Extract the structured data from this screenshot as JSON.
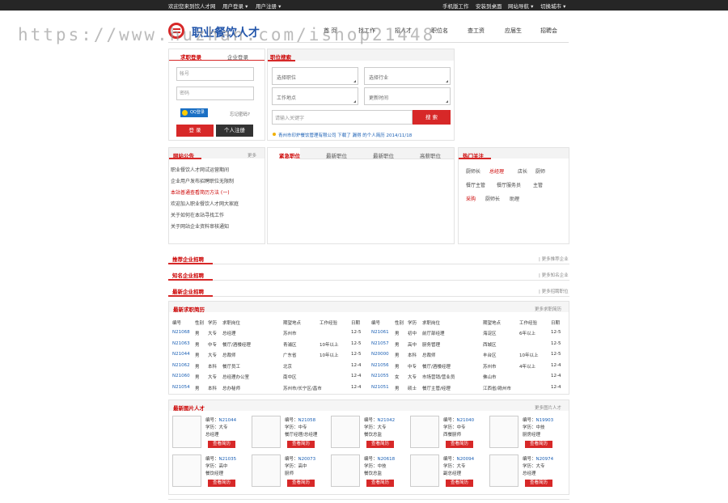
{
  "topbar": {
    "welcome": "欢迎您来到饮人才网",
    "user_login": "用户登录 ▾",
    "user_register": "用户注册 ▾",
    "mobile": "手机版工作",
    "install": "安装到桌面",
    "site_nav": "网站导航 ▾",
    "switch_city": "切换城市 ▾"
  },
  "watermark": "https://www.huzhan.com/ishop21448",
  "logo_text": "职业餐饮人才",
  "nav": [
    "首 页",
    "找工作",
    "招人才",
    "职位名",
    "查工资",
    "应届生",
    "招聘会"
  ],
  "login": {
    "tab_personal": "求职登录",
    "tab_company": "企业登录",
    "account_placeholder": "帐号",
    "password_placeholder": "密码",
    "qq_label": "QQ登录",
    "forgot": "忘记密码?",
    "login_btn": "登 录",
    "register_btn": "个人注册"
  },
  "job_search": {
    "title": "职位搜索",
    "select_position": "选择职位",
    "select_industry": "选择行业",
    "work_location": "工作地点",
    "update_time": "更新时间",
    "keyword_placeholder": "请输入关键字",
    "search_btn": "搜 索",
    "news": "青州市印炉餐饮管理有限公司 下载了 漏得 的个人简历 2014/11/18"
  },
  "notice": {
    "title": "网站公告",
    "more": "更多",
    "items": [
      "职业餐饮人才网试运营期间",
      "企业用户发布招聘职位无限制",
      "本站普通查看简历方法 (一)",
      "欢迎加入职业餐饮人才网大家庭",
      "关于如何在本站寻找工作",
      "关于网站企业资料审核通知"
    ]
  },
  "jobs_tabs": [
    "紧急职位",
    "最新职位",
    "最新职位",
    "高薪职位"
  ],
  "hot": {
    "title": "热门关注",
    "items": [
      {
        "t": "厨师长",
        "red": false
      },
      {
        "t": "总经理",
        "red": true
      },
      {
        "t": "店长",
        "red": false
      },
      {
        "t": "厨师",
        "red": false
      },
      {
        "t": "餐厅主管",
        "red": false
      },
      {
        "t": "餐厅服务员",
        "red": false
      },
      {
        "t": "主管",
        "red": false
      },
      {
        "t": "采购",
        "red": true
      },
      {
        "t": "厨师长",
        "red": false
      },
      {
        "t": "助理",
        "red": false
      }
    ]
  },
  "sections": [
    {
      "title": "推荐企业招聘",
      "more": "| 更多推荐企业"
    },
    {
      "title": "知名企业招聘",
      "more": "| 更多知名企业"
    },
    {
      "title": "最新企业招聘",
      "more": "| 更多招聘职位"
    }
  ],
  "resumes": {
    "title": "最新求职简历",
    "more": "更多求职简历",
    "headers": [
      "编号",
      "性别",
      "学历",
      "求职岗位",
      "期望地点",
      "工作经验",
      "日期"
    ],
    "left": [
      [
        "N21068",
        "男",
        "大专",
        "总经理",
        "苏州市",
        "",
        "12-5"
      ],
      [
        "N21063",
        "男",
        "中专",
        "餐厅/酒楼经理",
        "青浦区",
        "10年以上",
        "12-5"
      ],
      [
        "N21044",
        "男",
        "大专",
        "总裁师",
        "广东省",
        "10年以上",
        "12-5"
      ],
      [
        "N21062",
        "男",
        "本科",
        "餐厅员工",
        "北京",
        "",
        "12-4"
      ],
      [
        "N21060",
        "男",
        "大专",
        "总经理办公室",
        "南中区",
        "",
        "12-4"
      ],
      [
        "N21054",
        "男",
        "本科",
        "总办秘师",
        "苏州市/长宁区/昌市",
        "",
        "12-4"
      ]
    ],
    "right": [
      [
        "N21061",
        "男",
        "初中",
        "前厅部经理",
        "海淀区",
        "6年以上",
        "12-5"
      ],
      [
        "N21057",
        "男",
        "高中",
        "厨务管理",
        "西城区",
        "",
        "12-5"
      ],
      [
        "N20000",
        "男",
        "本科",
        "总裁师",
        "丰台区",
        "10年以上",
        "12-5"
      ],
      [
        "N21056",
        "男",
        "中专",
        "餐厅/酒楼经理",
        "苏州市",
        "4年以上",
        "12-4"
      ],
      [
        "N21055",
        "女",
        "大专",
        "市场营销/营业员",
        "佛山市",
        "",
        "12-4"
      ],
      [
        "N21051",
        "男",
        "硕士",
        "餐厅主管/经理",
        "江西省/赣州市",
        "",
        "12-4"
      ]
    ]
  },
  "photos": {
    "title": "最新图片人才",
    "more": "更多图片人才",
    "no_label": "编号：",
    "edu_label": "学历：",
    "btn": "查看简历",
    "cards": [
      {
        "no": "N21044",
        "edu": "大专",
        "job": "总经理"
      },
      {
        "no": "N21058",
        "edu": "中专",
        "job": "餐厅经理/总经理"
      },
      {
        "no": "N21042",
        "edu": "大专",
        "job": "餐饮总监"
      },
      {
        "no": "N21040",
        "edu": "中专",
        "job": "西餐厨师"
      },
      {
        "no": "N19903",
        "edu": "中技",
        "job": "厨房经理"
      },
      {
        "no": "N21035",
        "edu": "高中",
        "job": "餐饮经理"
      },
      {
        "no": "N20073",
        "edu": "高中",
        "job": "厨师"
      },
      {
        "no": "N20618",
        "edu": "中技",
        "job": "餐饮总监"
      },
      {
        "no": "N20094",
        "edu": "大专",
        "job": "副总经理"
      },
      {
        "no": "N20974",
        "edu": "大专",
        "job": "总经理"
      }
    ]
  }
}
